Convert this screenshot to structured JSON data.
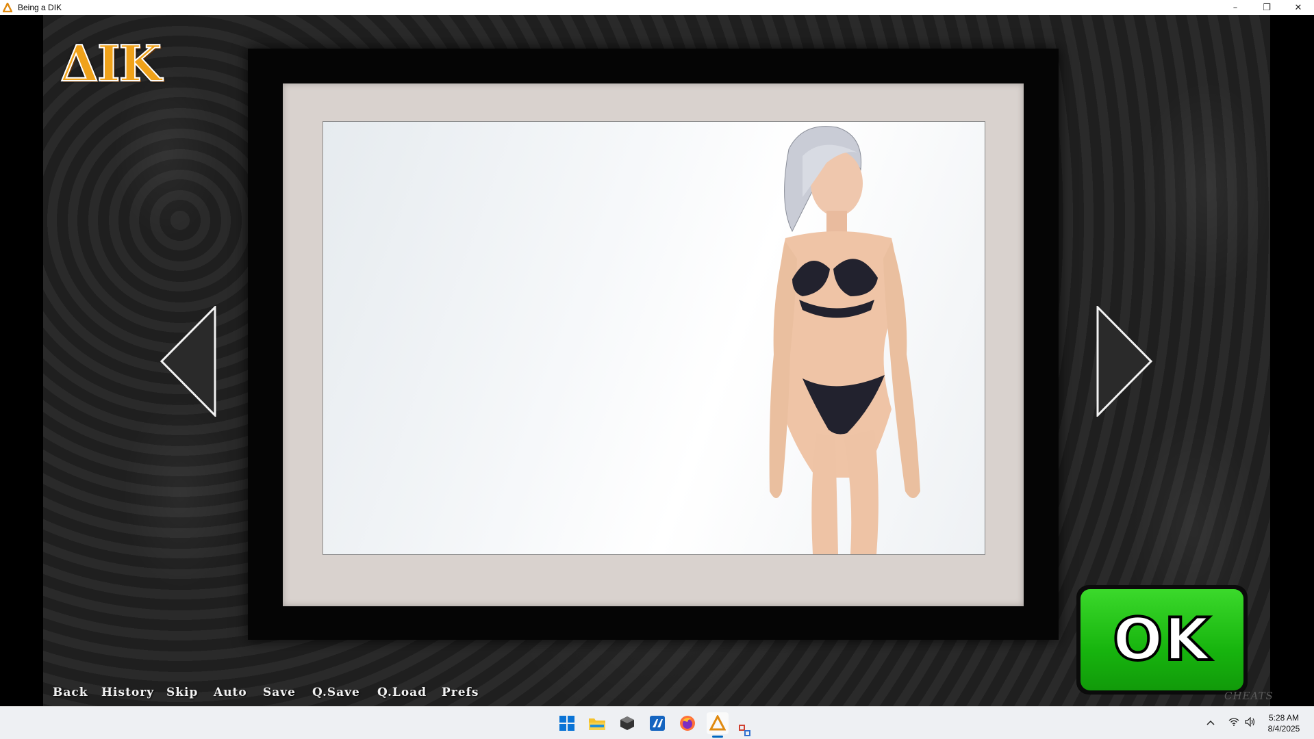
{
  "window": {
    "title": "Being a DIK",
    "controls": [
      "–",
      "❐",
      "✕"
    ]
  },
  "logo": {
    "text": "ΔIK"
  },
  "ok_button": {
    "label": "OK"
  },
  "quick_menu": [
    "Back",
    "History",
    "Skip",
    "Auto",
    "Save",
    "Q.Save",
    "Q.Load",
    "Prefs"
  ],
  "cheats_label": "CHEATS",
  "taskbar": {
    "apps": [
      "start-icon",
      "file-explorer-icon",
      "unity-hub-icon",
      "app-icon",
      "firefox-icon",
      "being-a-dik-icon",
      "snipping-icon"
    ],
    "clock": {
      "time": "5:28 AM",
      "date": "8/4/2025"
    }
  },
  "colors": {
    "ok_green": "#17b50e",
    "logo_orange": "#f0a21a",
    "mat": "#d9d2ce"
  }
}
